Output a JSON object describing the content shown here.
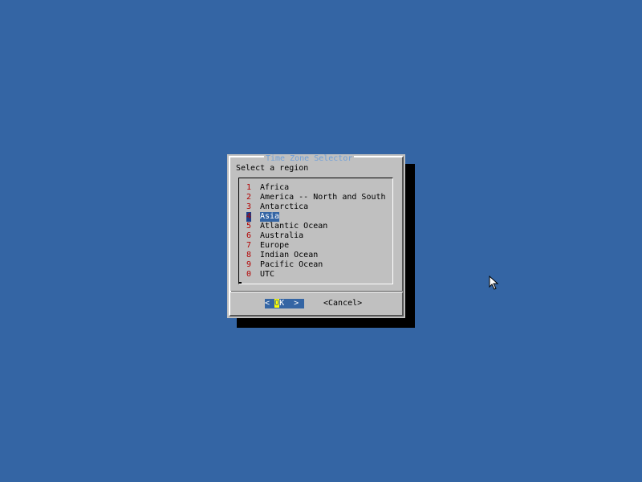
{
  "dialog": {
    "title": "Time Zone Selector",
    "prompt": "Select a region",
    "items": [
      {
        "key": "1",
        "label": "Africa"
      },
      {
        "key": "2",
        "label": "America -- North and South"
      },
      {
        "key": "3",
        "label": "Antarctica"
      },
      {
        "key": "4",
        "label": "Asia"
      },
      {
        "key": "5",
        "label": "Atlantic Ocean"
      },
      {
        "key": "6",
        "label": "Australia"
      },
      {
        "key": "7",
        "label": "Europe"
      },
      {
        "key": "8",
        "label": "Indian Ocean"
      },
      {
        "key": "9",
        "label": "Pacific Ocean"
      },
      {
        "key": "0",
        "label": "UTC"
      }
    ],
    "selected_index": 3,
    "ok_button": {
      "left": "< ",
      "hot": "O",
      "rest": "K  >"
    },
    "cancel_button": "<Cancel>"
  },
  "colors": {
    "desktop": "#3465a4",
    "dialog": "#c0c0c0",
    "shadow": "#000000",
    "title": "#6f9fd8",
    "hotkey": "#b20000",
    "highlight": "#3465a4",
    "hot_letter": "#ffff00"
  },
  "icons": {
    "cursor": "mouse-pointer-icon"
  }
}
